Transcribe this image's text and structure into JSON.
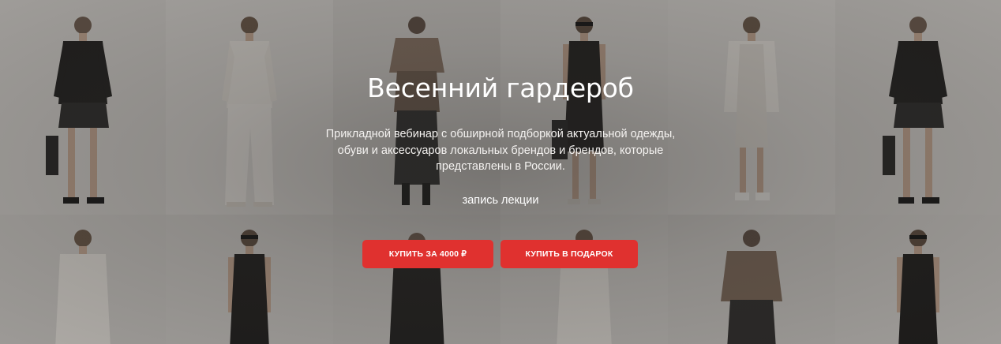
{
  "hero": {
    "title": "Весенний гардероб",
    "description": "Прикладной вебинар с обширной подборкой актуальной одежды, обуви и аксессуаров локальных брендов и брендов, которые представлены в России.",
    "subtitle": "запись лекции",
    "buy_button_label": "КУПИТЬ ЗА 4000 ₽",
    "gift_button_label": "КУПИТЬ В ПОДАРОК"
  },
  "colors": {
    "accent": "#e0312f",
    "text": "#ffffff",
    "background": "#d9d6d2"
  }
}
